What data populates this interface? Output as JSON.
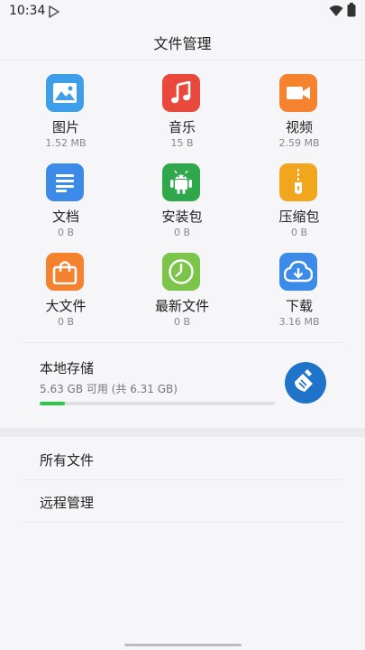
{
  "status": {
    "time": "10:34"
  },
  "app": {
    "title": "文件管理"
  },
  "categories": [
    {
      "label": "图片",
      "size": "1.52 MB",
      "icon": "image-icon",
      "color": "#3d9eea"
    },
    {
      "label": "音乐",
      "size": "15 B",
      "icon": "music-icon",
      "color": "#e8493c"
    },
    {
      "label": "视频",
      "size": "2.59 MB",
      "icon": "video-icon",
      "color": "#f4822f"
    },
    {
      "label": "文档",
      "size": "0 B",
      "icon": "document-icon",
      "color": "#3d8be8"
    },
    {
      "label": "安装包",
      "size": "0 B",
      "icon": "android-icon",
      "color": "#2ea84b"
    },
    {
      "label": "压缩包",
      "size": "0 B",
      "icon": "zip-icon",
      "color": "#f2a61d"
    },
    {
      "label": "大文件",
      "size": "0 B",
      "icon": "bag-icon",
      "color": "#f4822f"
    },
    {
      "label": "最新文件",
      "size": "0 B",
      "icon": "clock-icon",
      "color": "#7cc44a"
    },
    {
      "label": "下载",
      "size": "3.16 MB",
      "icon": "cloud-download-icon",
      "color": "#3d8be8"
    }
  ],
  "storage": {
    "title": "本地存储",
    "subtitle": "5.63 GB 可用 (共 6.31 GB)",
    "used_fraction": 0.108,
    "bar_color": "#2fc44a",
    "clean_icon": "broom-icon",
    "clean_color": "#1f74c9"
  },
  "menu": [
    {
      "label": "所有文件"
    },
    {
      "label": "远程管理"
    }
  ]
}
